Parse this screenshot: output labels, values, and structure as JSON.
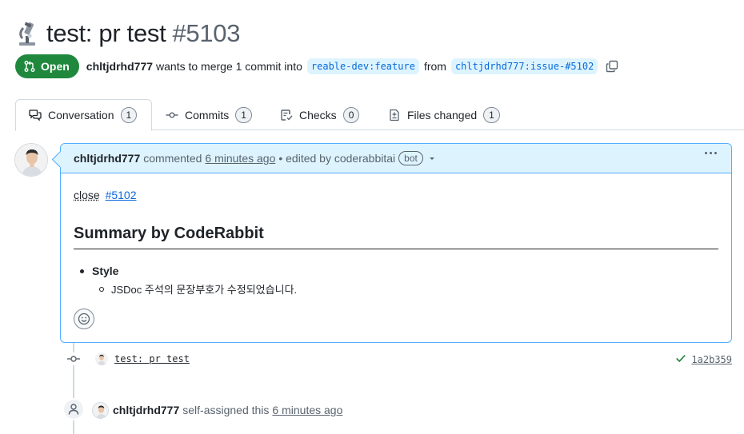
{
  "pr": {
    "emoji": "microscope-icon",
    "title": "test: pr test",
    "number": "#5103"
  },
  "meta": {
    "state": "Open",
    "author": "chltjdrhd777",
    "merge_text": "wants to merge 1 commit into",
    "base_branch": "reable-dev:feature",
    "from_text": "from",
    "head_branch": "chltjdrhd777:issue-#5102"
  },
  "tabs": [
    {
      "label": "Conversation",
      "count": "1",
      "icon": "comment-discussion-icon"
    },
    {
      "label": "Commits",
      "count": "1",
      "icon": "git-commit-icon"
    },
    {
      "label": "Checks",
      "count": "0",
      "icon": "checklist-icon"
    },
    {
      "label": "Files changed",
      "count": "1",
      "icon": "file-diff-icon"
    }
  ],
  "comment": {
    "author": "chltjdrhd777",
    "action": "commented",
    "time": "6 minutes ago",
    "edited": "• edited by coderabbitai",
    "bot_badge": "bot",
    "close_word": "close",
    "close_ref": "#5102",
    "heading": "Summary by CodeRabbit",
    "bullet": "Style",
    "sub_bullet": "JSDoc 주석의 문장부호가 수정되었습니다."
  },
  "commit": {
    "message": "test: pr test",
    "sha": "1a2b359",
    "status": "success"
  },
  "assign_event": {
    "author": "chltjdrhd777",
    "text": "self-assigned this",
    "time": "6 minutes ago"
  },
  "colors": {
    "open_green": "#1f883d",
    "link_blue": "#0969da",
    "header_bg": "#ddf4ff",
    "border_blue": "#54aeff"
  }
}
